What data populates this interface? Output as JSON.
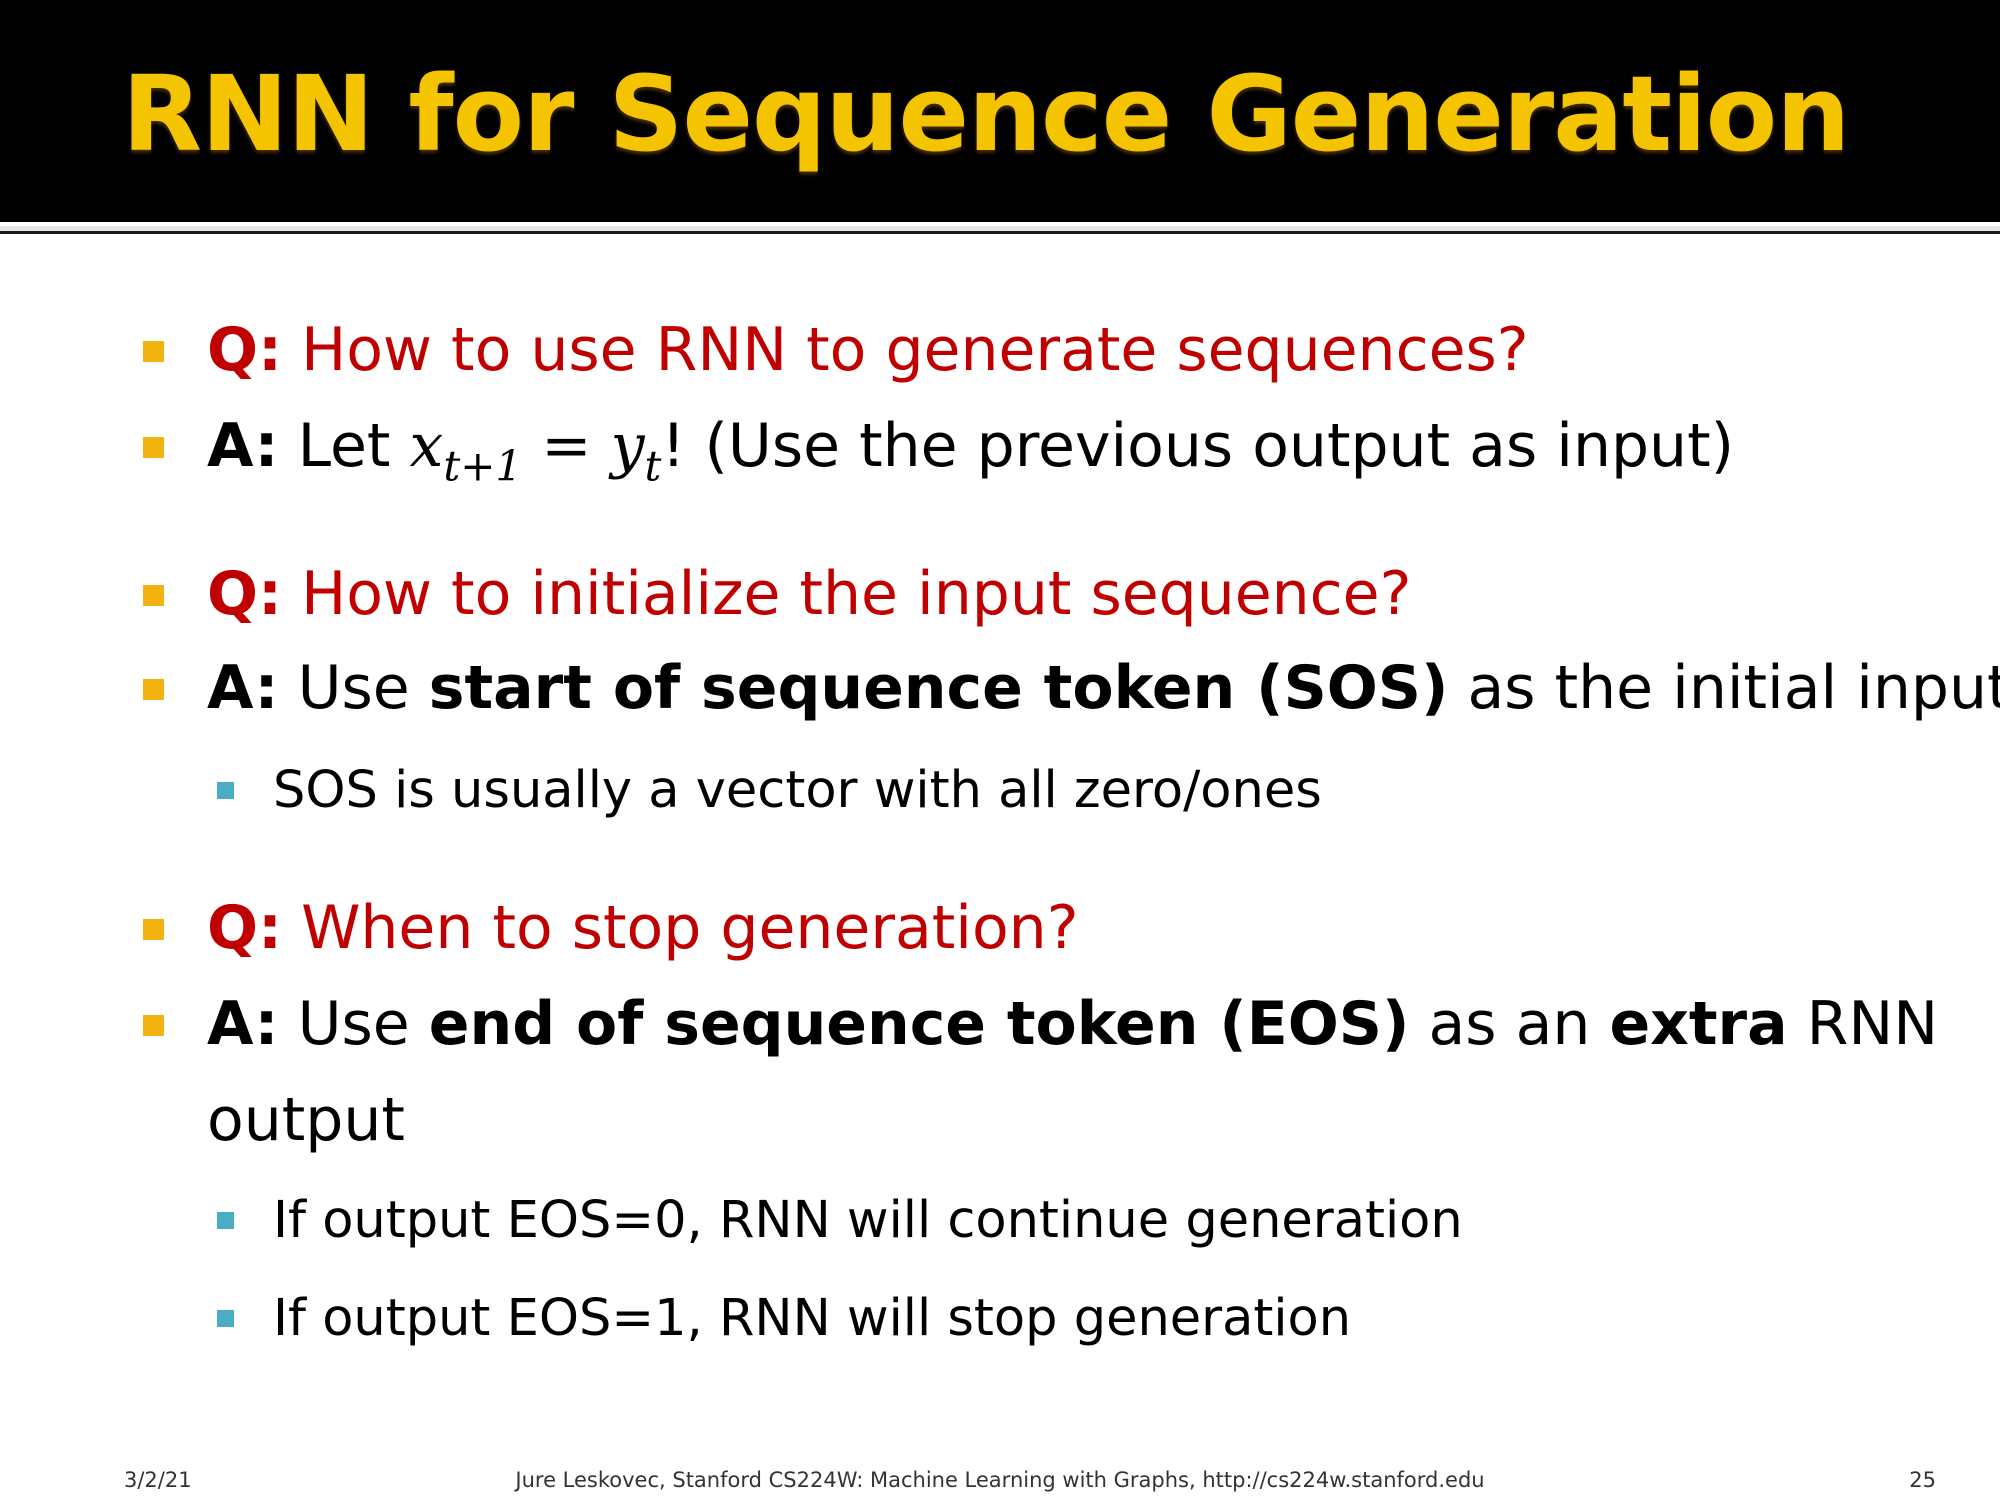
{
  "title": "RNN for Sequence Generation",
  "colors": {
    "title": "#f5c400",
    "title_bar": "#000000",
    "question": "#c00000",
    "bullet_marker": "#f2b20f",
    "sub_bullet_marker": "#4bacc6"
  },
  "bullets": [
    {
      "prefix": "Q:",
      "text": " How to use RNN to generate sequences?"
    },
    {
      "prefix": "A:",
      "text_before": " Let ",
      "math_lhs": "x",
      "math_lhs_sub": "t+1",
      "math_eq": " = ",
      "math_rhs": "y",
      "math_rhs_sub": "t",
      "text_after": "! (Use the previous output as input)"
    },
    {
      "prefix": "Q:",
      "text": " How to initialize the input sequence?"
    },
    {
      "prefix": "A:",
      "text_before": " Use ",
      "bold": "start of sequence token (SOS)",
      "text_after": " as the initial input",
      "subs": [
        "SOS is usually a vector with all zero/ones"
      ]
    },
    {
      "prefix": "Q:",
      "text": " When to stop generation?"
    },
    {
      "prefix": "A:",
      "text_before": " Use ",
      "bold": "end of sequence token (EOS)",
      "text_mid": " as an ",
      "bold2": "extra",
      "text_after": " RNN",
      "continuation": "output",
      "subs": [
        "If output EOS=0, RNN will continue generation",
        "If output EOS=1, RNN will stop generation"
      ]
    }
  ],
  "footer": {
    "date": "3/2/21",
    "credit": "Jure Leskovec, Stanford CS224W: Machine Learning with Graphs, http://cs224w.stanford.edu",
    "page": "25"
  }
}
